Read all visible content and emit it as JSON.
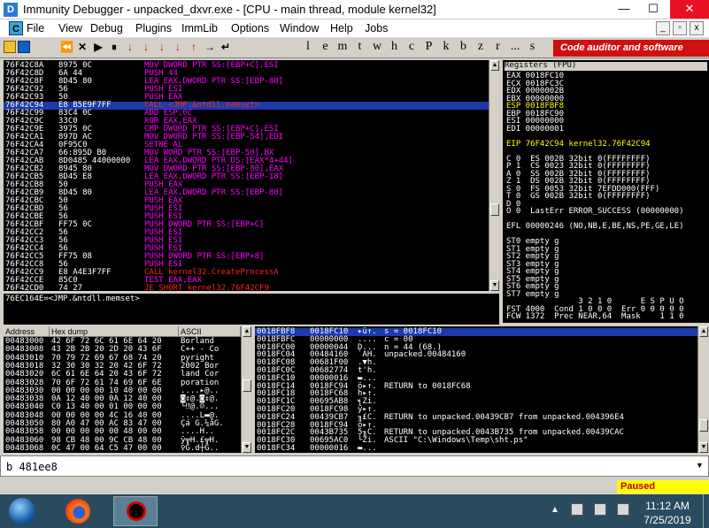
{
  "window": {
    "title": "Immunity Debugger - unpacked_dxvr.exe - [CPU - main thread, module kernel32]",
    "minimize": "—",
    "maximize": "☐",
    "close": "✕"
  },
  "menu": {
    "cpu_icon": "C",
    "items": [
      "File",
      "View",
      "Debug",
      "Plugins",
      "ImmLib",
      "Options",
      "Window",
      "Help",
      "Jobs"
    ],
    "mdi_min": "_",
    "mdi_max": "▫",
    "mdi_close": "x"
  },
  "toolbar": {
    "buttons": [
      "⏪",
      "✕",
      "▶",
      "⏸",
      "↓",
      "↓",
      "↓",
      "↓",
      "↑",
      "→",
      "↵"
    ],
    "letters": [
      "l",
      "e",
      "m",
      "t",
      "w",
      "h",
      "c",
      "P",
      "k",
      "b",
      "z",
      "r",
      "...",
      "s"
    ],
    "ad": "Code auditor and software assess"
  },
  "disasm": {
    "selected_index": 7,
    "rows": [
      {
        "addr": "76F42C8A",
        "hex": "8975 0C",
        "text": "MOV DWORD PTR SS:[EBP+C],ESI",
        "color": "#ff00ff"
      },
      {
        "addr": "76F42C8D",
        "hex": "6A 44",
        "text": "PUSH 44",
        "color": "#ff00ff"
      },
      {
        "addr": "76F42C8F",
        "hex": "8D45 80",
        "text": "LEA EAX,DWORD PTR SS:[EBP-80]",
        "color": "#ff00ff"
      },
      {
        "addr": "76F42C92",
        "hex": "56",
        "text": "PUSH ESI",
        "color": "#ff00ff"
      },
      {
        "addr": "76F42C93",
        "hex": "50",
        "text": "PUSH EAX",
        "color": "#ff00ff"
      },
      {
        "addr": "76F42C94",
        "hex": "E8 B5E9F7FF",
        "text": "CALL <JMP.&ntdll.memset>",
        "color": "#ff2020"
      },
      {
        "addr": "76F42C99",
        "hex": "83C4 0C",
        "text": "ADD ESP,0C",
        "color": "#ff00ff"
      },
      {
        "addr": "76F42C9C",
        "hex": "33C0",
        "text": "XOR EAX,EAX",
        "color": "#ff00ff"
      },
      {
        "addr": "76F42C9E",
        "hex": "3975 0C",
        "text": "CMP DWORD PTR SS:[EBP+C],ESI",
        "color": "#ff00ff"
      },
      {
        "addr": "76F42CA1",
        "hex": "897D AC",
        "text": "MOV DWORD PTR SS:[EBP-54],EDI",
        "color": "#ff00ff"
      },
      {
        "addr": "76F42CA4",
        "hex": "0F95C0",
        "text": "SETNE AL",
        "color": "#ff00ff"
      },
      {
        "addr": "76F42CA7",
        "hex": "66:895D B0",
        "text": "MOV WORD PTR SS:[EBP-50],BX",
        "color": "#ff00ff"
      },
      {
        "addr": "76F42CAB",
        "hex": "8D0485 44000000",
        "text": "LEA EAX,DWORD PTR DS:[EAX*4+44]",
        "color": "#ff00ff"
      },
      {
        "addr": "76F42CB2",
        "hex": "8945 80",
        "text": "MOV DWORD PTR SS:[EBP-80],EAX",
        "color": "#ff00ff"
      },
      {
        "addr": "76F42CB5",
        "hex": "8D45 E8",
        "text": "LEA EAX,DWORD PTR SS:[EBP-18]",
        "color": "#ff00ff"
      },
      {
        "addr": "76F42CB8",
        "hex": "50",
        "text": "PUSH EAX",
        "color": "#ff00ff"
      },
      {
        "addr": "76F42CB9",
        "hex": "8D45 80",
        "text": "LEA EAX,DWORD PTR SS:[EBP-80]",
        "color": "#ff00ff"
      },
      {
        "addr": "76F42CBC",
        "hex": "50",
        "text": "PUSH EAX",
        "color": "#ff00ff"
      },
      {
        "addr": "76F42CBD",
        "hex": "56",
        "text": "PUSH ESI",
        "color": "#ff00ff"
      },
      {
        "addr": "76F42CBE",
        "hex": "56",
        "text": "PUSH ESI",
        "color": "#ff00ff"
      },
      {
        "addr": "76F42CBF",
        "hex": "FF75 0C",
        "text": "PUSH DWORD PTR SS:[EBP+C]",
        "color": "#ff00ff"
      },
      {
        "addr": "76F42CC2",
        "hex": "56",
        "text": "PUSH ESI",
        "color": "#ff00ff"
      },
      {
        "addr": "76F42CC3",
        "hex": "56",
        "text": "PUSH ESI",
        "color": "#ff00ff"
      },
      {
        "addr": "76F42CC4",
        "hex": "56",
        "text": "PUSH ESI",
        "color": "#ff00ff"
      },
      {
        "addr": "76F42CC5",
        "hex": "FF75 08",
        "text": "PUSH DWORD PTR SS:[EBP+8]",
        "color": "#ff00ff"
      },
      {
        "addr": "76F42CC8",
        "hex": "56",
        "text": "PUSH ESI",
        "color": "#ff00ff"
      },
      {
        "addr": "76F42CC9",
        "hex": "E8 A4E3F7FF",
        "text": "CALL kernel32.CreateProcessA",
        "color": "#ff2020"
      },
      {
        "addr": "76F42CCE",
        "hex": "85C0",
        "text": "TEST EAX,EAX",
        "color": "#ff00ff"
      },
      {
        "addr": "76F42CD0",
        "hex": "74 27",
        "text": "JE SHORT kernel32.76F42CF9",
        "color": "#ff2020"
      }
    ]
  },
  "info_line": "76EC164E=<JMP.&ntdll.memset>",
  "registers": {
    "header": "Registers (FPU)",
    "lines": [
      "EAX 0018FC10",
      "ECX 0018FC3C",
      "EDX 0000002B",
      "EBX 00000000",
      "ESP 0018FBF8",
      "EBP 0018FC90",
      "ESI 00000000",
      "EDI 00000001",
      "",
      "EIP 76F42C94 kernel32.76F42C94",
      "",
      "C 0  ES 002B 32bit 0(FFFFFFFF)",
      "P 1  CS 0023 32bit 0(FFFFFFFF)",
      "A 0  SS 002B 32bit 0(FFFFFFFF)",
      "Z 1  DS 002B 32bit 0(FFFFFFFF)",
      "S 0  FS 0053 32bit 7EFDD000(FFF)",
      "T 0  GS 002B 32bit 0(FFFFFFFF)",
      "D 0",
      "O 0  LastErr ERROR_SUCCESS (00000000)",
      "",
      "EFL 00000246 (NO,NB,E,BE,NS,PE,GE,LE)",
      "",
      "ST0 empty g",
      "ST1 empty g",
      "ST2 empty g",
      "ST3 empty g",
      "ST4 empty g",
      "ST5 empty g",
      "ST6 empty g",
      "ST7 empty g",
      "               3 2 1 0      E S P U O",
      "FST 4000  Cond 1 0 0 0  Err 0 0 0 0 0",
      "FCW 1372  Prec NEAR,64  Mask    1 1 0"
    ]
  },
  "dump": {
    "headers": [
      "Address",
      "Hex dump",
      "ASCII"
    ],
    "rows": [
      [
        "00483000",
        "42 6F 72 6C 61 6E 64 20",
        "Borland "
      ],
      [
        "00483008",
        "43 2B 2B 20 2D 20 43 6F",
        "C++ - Co"
      ],
      [
        "00483010",
        "70 79 72 69 67 68 74 20",
        "pyright "
      ],
      [
        "00483018",
        "32 30 30 32 20 42 6F 72",
        "2002 Bor"
      ],
      [
        "00483020",
        "6C 61 6E 64 20 43 6F 72",
        "land Cor"
      ],
      [
        "00483028",
        "70 6F 72 61 74 69 6F 6E",
        "poration"
      ],
      [
        "00483030",
        "00 00 00 00 10 40 00 00",
        "....▸@.."
      ],
      [
        "00483038",
        "0A 12 40 00 0A 12 40 00",
        "◙↕@.◙↕@."
      ],
      [
        "00483040",
        "C0 13 40 00 01 00 00 00",
        "└‼@.☺..."
      ],
      [
        "00483048",
        "00 00 00 00 4C 16 40 00",
        "....L▬@."
      ],
      [
        "00483050",
        "80 A0 47 00 AC 83 47 00",
        "Çá G.¼âG."
      ],
      [
        "00483058",
        "00 00 00 00 00 48 00 00",
        "....H.."
      ],
      [
        "00483060",
        "98 CB 48 00 9C CB 48 00",
        "ÿ╦H.£╦H."
      ],
      [
        "00483068",
        "0C 47 00 64 C5 47 00 00",
        "♀G.d┼G.."
      ]
    ]
  },
  "stack": {
    "rows": [
      {
        "addr": "0018FBF8",
        "val": "0018FC10",
        "asc": "▸ü↑.",
        "cmt": "s = 0018FC10"
      },
      {
        "addr": "0018FBFC",
        "val": "00000000",
        "asc": "....",
        "cmt": "c = 00"
      },
      {
        "addr": "0018FC00",
        "val": "00000044",
        "asc": "D...",
        "cmt": "n = 44 (68.)"
      },
      {
        "addr": "0018FC04",
        "val": "00484160",
        "asc": "`AH.",
        "cmt": "unpacked.00484160"
      },
      {
        "addr": "0018FC08",
        "val": "00681F00",
        "asc": ".▼h.",
        "cmt": ""
      },
      {
        "addr": "0018FC0C",
        "val": "00682774",
        "asc": "t'h.",
        "cmt": ""
      },
      {
        "addr": "0018FC10",
        "val": "00000016",
        "asc": "▬...",
        "cmt": ""
      },
      {
        "addr": "0018FC14",
        "val": "0018FC94",
        "asc": "ö▸↑.",
        "cmt": "RETURN to 0018FC68"
      },
      {
        "addr": "0018FC18",
        "val": "0018FC68",
        "asc": "h▸↑.",
        "cmt": ""
      },
      {
        "addr": "0018FC1C",
        "val": "00695AB8",
        "asc": "╕Zi.",
        "cmt": ""
      },
      {
        "addr": "0018FC20",
        "val": "0018FC98",
        "asc": "ÿ▸↑.",
        "cmt": ""
      },
      {
        "addr": "0018FC24",
        "val": "00439CB7",
        "asc": "╖£C.",
        "cmt": "RETURN to unpacked.00439CB7 from unpacked.004396E4"
      },
      {
        "addr": "0018FC28",
        "val": "0018FC94",
        "asc": "ö▸↑.",
        "cmt": ""
      },
      {
        "addr": "0018FC2C",
        "val": "0043B735",
        "asc": "5╖C.",
        "cmt": "RETURN to unpacked.0043B735 from unpacked.00439CAC"
      },
      {
        "addr": "0018FC30",
        "val": "00695AC0",
        "asc": "└Zi.",
        "cmt": "ASCII \"C:\\Windows\\Temp\\sht.ps\""
      },
      {
        "addr": "0018FC34",
        "val": "00000016",
        "asc": "▬...",
        "cmt": ""
      }
    ]
  },
  "command": {
    "value": "b 481ee8"
  },
  "status": {
    "paused": "Paused"
  },
  "taskbar": {
    "time": "11:12 AM",
    "date": "7/25/2019"
  }
}
